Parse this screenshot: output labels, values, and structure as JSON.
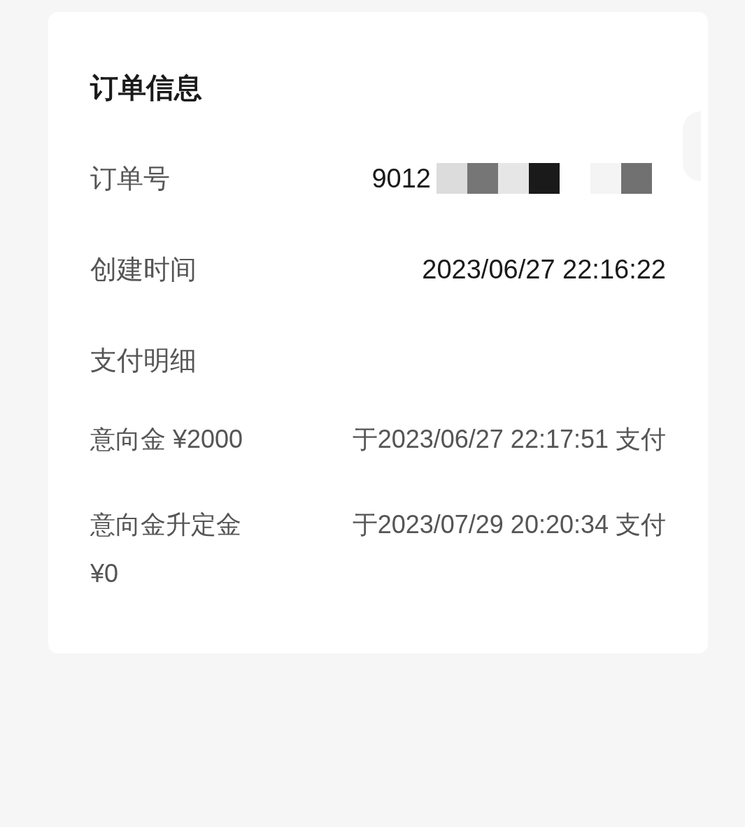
{
  "card": {
    "title": "订单信息",
    "fields": [
      {
        "label": "订单号",
        "value": "9012",
        "redacted": true
      },
      {
        "label": "创建时间",
        "value": "2023/06/27 22:16:22",
        "redacted": false
      }
    ],
    "section_title": "支付明细",
    "payments": [
      {
        "label": "意向金 ¥2000",
        "value": "于2023/06/27 22:17:51 支付"
      },
      {
        "label": "意向金升定金 ¥0",
        "value": "于2023/07/29 20:20:34 支付"
      }
    ]
  }
}
